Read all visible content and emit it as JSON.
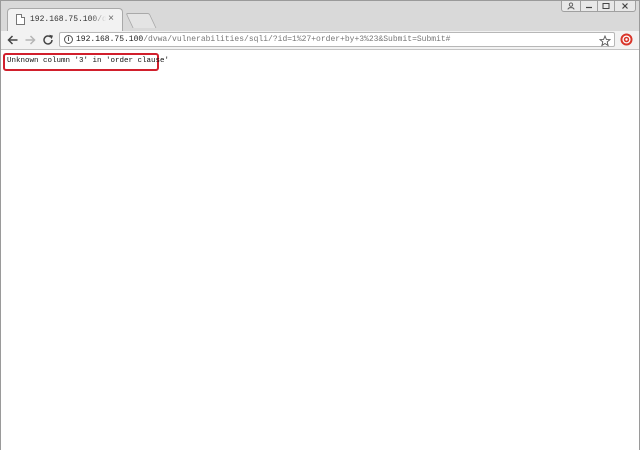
{
  "tab": {
    "title": "192.168.75.100/dvwa/vu",
    "close_glyph": "×",
    "icon": "page-icon"
  },
  "window_controls": {
    "user_icon": "user-icon",
    "minimize_icon": "minimize-icon",
    "maximize_icon": "maximize-icon",
    "close_icon": "close-icon"
  },
  "toolbar": {
    "back_icon": "back-arrow-icon",
    "forward_icon": "forward-arrow-icon",
    "reload_icon": "reload-icon",
    "info_glyph": "i",
    "url_host": "192.168.75.100",
    "url_rest": "/dvwa/vulnerabilities/sqli/?id=1%27+order+by+3%23&Submit=Submit#",
    "star_icon": "star-icon",
    "extension_icon": "extension-icon"
  },
  "page": {
    "error_message": "Unknown column '3' in 'order clause'"
  },
  "colors": {
    "highlight_box": "#d11f2c",
    "extension": "#d9352a"
  }
}
